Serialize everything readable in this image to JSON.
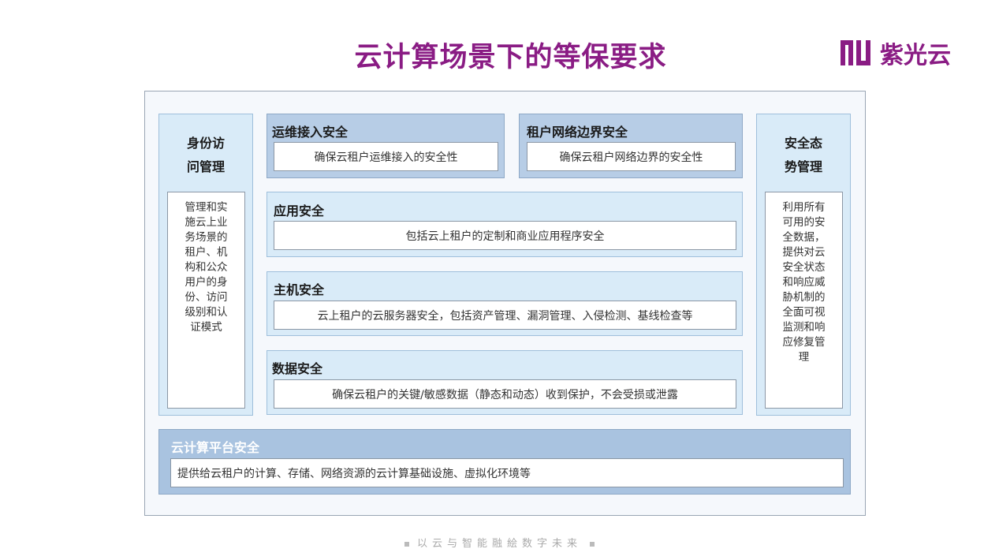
{
  "title": "云计算场景下的等保要求",
  "logo": {
    "text": "紫光云",
    "icon": "unisyscloud-logo-icon"
  },
  "colors": {
    "brand": "#8a1c84",
    "panel_dark": "#b7cde6",
    "panel_light": "#d9ebf8",
    "platform": "#a9c3e0"
  },
  "left_panel": {
    "title": [
      "身份访",
      "问管理"
    ],
    "body": [
      "管理和实",
      "施云上业",
      "务场景的",
      "租户、机",
      "构和公众",
      "用户的身",
      "份、访问",
      "级别和认",
      "证模式"
    ]
  },
  "right_panel": {
    "title": [
      "安全态",
      "势管理"
    ],
    "body": [
      "利用所有",
      "可用的安",
      "全数据，",
      "提供对云",
      "安全状态",
      "和响应威",
      "胁机制的",
      "全面可视",
      "监测和响",
      "应修复管",
      "理"
    ]
  },
  "sections": {
    "ops_access": {
      "title": "运维接入安全",
      "desc": "确保云租户运维接入的安全性"
    },
    "tenant_boundary": {
      "title": "租户网络边界安全",
      "desc": "确保云租户网络边界的安全性"
    },
    "app": {
      "title": "应用安全",
      "desc": "包括云上租户的定制和商业应用程序安全"
    },
    "host": {
      "title": "主机安全",
      "desc": "云上租户的云服务器安全，包括资产管理、漏洞管理、入侵检测、基线检查等"
    },
    "data": {
      "title": "数据安全",
      "desc": "确保云租户的关键/敏感数据（静态和动态）收到保护，不会受损或泄露"
    }
  },
  "platform": {
    "title": "云计算平台安全",
    "desc": "提供给云租户的计算、存储、网络资源的云计算基础设施、虚拟化环境等"
  },
  "footer": "以云与智能融絵数字未来"
}
